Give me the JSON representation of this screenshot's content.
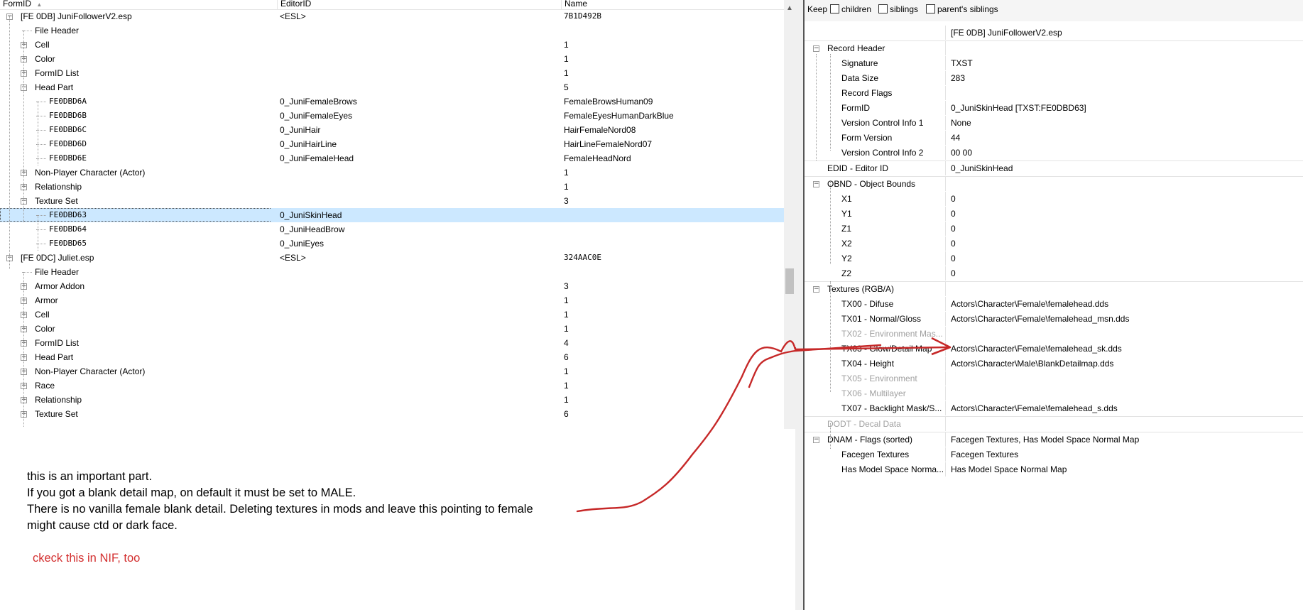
{
  "left": {
    "columns": {
      "formid": "FormID",
      "editorid": "EditorID",
      "name": "Name"
    },
    "rows": [
      {
        "c0": "[FE 0DB] JuniFollowerV2.esp",
        "c1": "<ESL>",
        "c2": "7B1D492B"
      },
      {
        "c0": "File Header",
        "c1": "",
        "c2": ""
      },
      {
        "c0": "Cell",
        "c1": "",
        "c2": "1"
      },
      {
        "c0": "Color",
        "c1": "",
        "c2": "1"
      },
      {
        "c0": "FormID List",
        "c1": "",
        "c2": "1"
      },
      {
        "c0": "Head Part",
        "c1": "",
        "c2": "5"
      },
      {
        "c0": "FE0DBD6A",
        "c1": "0_JuniFemaleBrows",
        "c2": "FemaleBrowsHuman09"
      },
      {
        "c0": "FE0DBD6B",
        "c1": "0_JuniFemaleEyes",
        "c2": "FemaleEyesHumanDarkBlue"
      },
      {
        "c0": "FE0DBD6C",
        "c1": "0_JuniHair",
        "c2": "HairFemaleNord08"
      },
      {
        "c0": "FE0DBD6D",
        "c1": "0_JuniHairLine",
        "c2": "HairLineFemaleNord07"
      },
      {
        "c0": "FE0DBD6E",
        "c1": "0_JuniFemaleHead",
        "c2": "FemaleHeadNord"
      },
      {
        "c0": "Non-Player Character (Actor)",
        "c1": "",
        "c2": "1"
      },
      {
        "c0": "Relationship",
        "c1": "",
        "c2": "1"
      },
      {
        "c0": "Texture Set",
        "c1": "",
        "c2": "3"
      },
      {
        "c0": "FE0DBD63",
        "c1": "0_JuniSkinHead",
        "c2": ""
      },
      {
        "c0": "FE0DBD64",
        "c1": "0_JuniHeadBrow",
        "c2": ""
      },
      {
        "c0": "FE0DBD65",
        "c1": "0_JuniEyes",
        "c2": ""
      },
      {
        "c0": "[FE 0DC] Juliet.esp",
        "c1": "<ESL>",
        "c2": "324AAC0E"
      },
      {
        "c0": "File Header",
        "c1": "",
        "c2": ""
      },
      {
        "c0": "Armor Addon",
        "c1": "",
        "c2": "3"
      },
      {
        "c0": "Armor",
        "c1": "",
        "c2": "1"
      },
      {
        "c0": "Cell",
        "c1": "",
        "c2": "1"
      },
      {
        "c0": "Color",
        "c1": "",
        "c2": "1"
      },
      {
        "c0": "FormID List",
        "c1": "",
        "c2": "4"
      },
      {
        "c0": "Head Part",
        "c1": "",
        "c2": "6"
      },
      {
        "c0": "Non-Player Character (Actor)",
        "c1": "",
        "c2": "1"
      },
      {
        "c0": "Race",
        "c1": "",
        "c2": "1"
      },
      {
        "c0": "Relationship",
        "c1": "",
        "c2": "1"
      },
      {
        "c0": "Texture Set",
        "c1": "",
        "c2": "6"
      }
    ]
  },
  "annotation": {
    "lines": [
      "this is an important part.",
      "If you got a blank detail map, on default it must be set to MALE.",
      "There is no vanilla female blank detail. Deleting textures in mods and leave this pointing to female",
      "might cause ctd or dark face."
    ],
    "note_red": "ckeck this in NIF, too"
  },
  "right": {
    "keep": {
      "label": "Keep",
      "children": "children",
      "siblings": "siblings",
      "parents_siblings": "parent's siblings"
    },
    "rows": [
      {
        "name": "",
        "value": "[FE 0DB] JuniFollowerV2.esp"
      },
      {
        "name": "Record Header",
        "value": ""
      },
      {
        "name": "Signature",
        "value": "TXST"
      },
      {
        "name": "Data Size",
        "value": "283"
      },
      {
        "name": "Record Flags",
        "value": ""
      },
      {
        "name": "FormID",
        "value": "0_JuniSkinHead [TXST:FE0DBD63]"
      },
      {
        "name": "Version Control Info 1",
        "value": "None"
      },
      {
        "name": "Form Version",
        "value": "44"
      },
      {
        "name": "Version Control Info 2",
        "value": "00 00"
      },
      {
        "name": "EDID - Editor ID",
        "value": "0_JuniSkinHead"
      },
      {
        "name": "OBND - Object Bounds",
        "value": ""
      },
      {
        "name": "X1",
        "value": "0"
      },
      {
        "name": "Y1",
        "value": "0"
      },
      {
        "name": "Z1",
        "value": "0"
      },
      {
        "name": "X2",
        "value": "0"
      },
      {
        "name": "Y2",
        "value": "0"
      },
      {
        "name": "Z2",
        "value": "0"
      },
      {
        "name": "Textures (RGB/A)",
        "value": ""
      },
      {
        "name": "TX00 - Difuse",
        "value": "Actors\\Character\\Female\\femalehead.dds"
      },
      {
        "name": "TX01 - Normal/Gloss",
        "value": "Actors\\Character\\Female\\femalehead_msn.dds"
      },
      {
        "name": "TX02 - Environment Mas...",
        "value": ""
      },
      {
        "name": "TX03 - Glow/Detail Map",
        "value": "Actors\\Character\\Female\\femalehead_sk.dds"
      },
      {
        "name": "TX04 - Height",
        "value": "Actors\\Character\\Male\\BlankDetailmap.dds"
      },
      {
        "name": "TX05 - Environment",
        "value": ""
      },
      {
        "name": "TX06 - Multilayer",
        "value": ""
      },
      {
        "name": "TX07 - Backlight Mask/S...",
        "value": "Actors\\Character\\Female\\femalehead_s.dds"
      },
      {
        "name": "DODT - Decal Data",
        "value": ""
      },
      {
        "name": "DNAM - Flags (sorted)",
        "value": "Facegen Textures, Has Model Space Normal Map"
      },
      {
        "name": "Facegen Textures",
        "value": "Facegen Textures"
      },
      {
        "name": "Has Model Space Norma...",
        "value": "Has Model Space Normal Map"
      }
    ]
  },
  "colors": {
    "selection": "#cce8ff",
    "annotation_red": "#d32f2f",
    "arrow": "#c62828"
  }
}
